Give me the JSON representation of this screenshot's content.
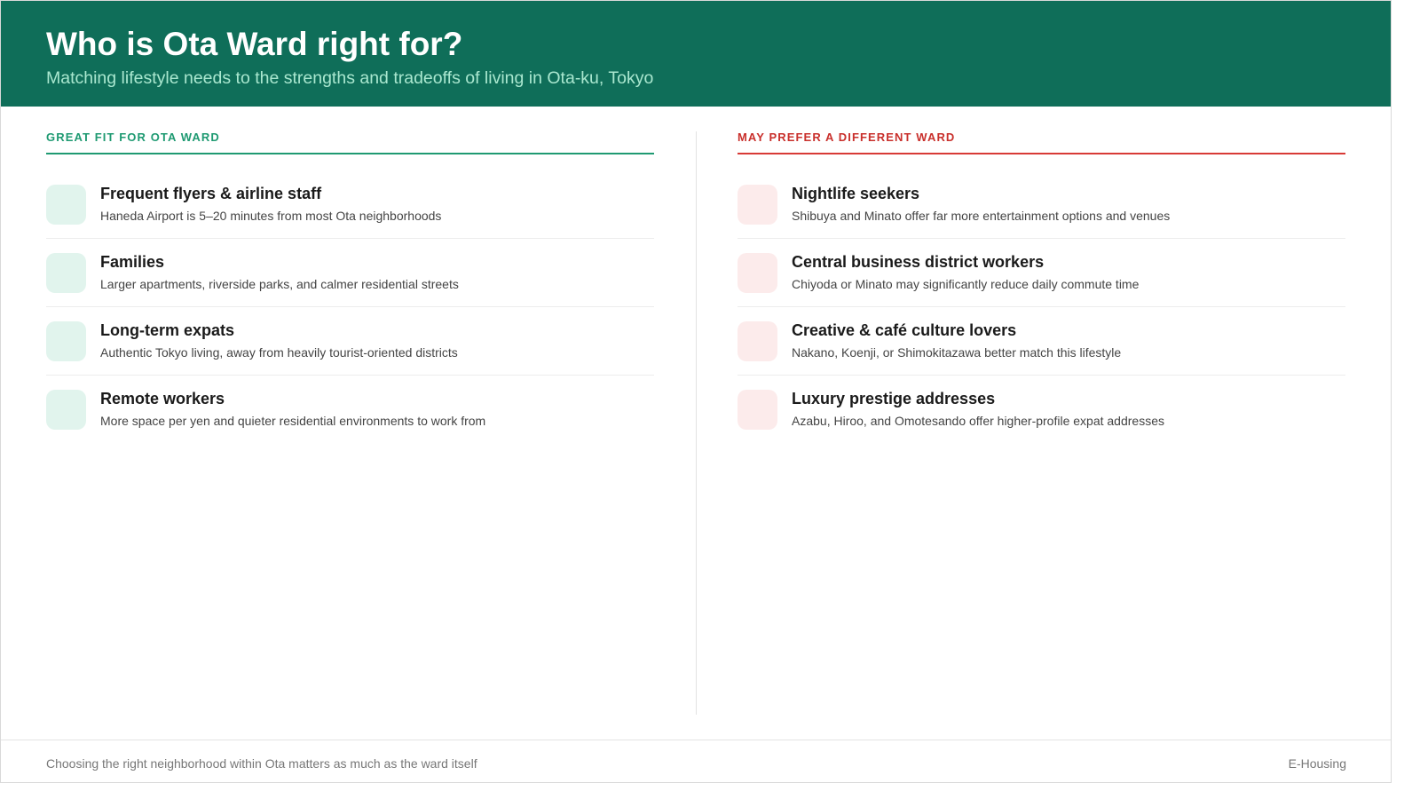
{
  "header": {
    "title": "Who is Ota Ward right for?",
    "subtitle": "Matching lifestyle needs to the strengths and tradeoffs of living in Ota-ku, Tokyo"
  },
  "colors": {
    "header_bg": "#0f6e59",
    "good_accent": "#1f9a72",
    "bad_accent": "#c9302c"
  },
  "good_fit": {
    "heading": "GREAT FIT FOR OTA WARD",
    "items": [
      {
        "title": "Frequent flyers & airline staff",
        "desc": "Haneda Airport is 5–20 minutes from most Ota neighborhoods"
      },
      {
        "title": "Families",
        "desc": "Larger apartments, riverside parks, and calmer residential streets"
      },
      {
        "title": "Long-term expats",
        "desc": "Authentic Tokyo living, away from heavily tourist-oriented districts"
      },
      {
        "title": "Remote workers",
        "desc": "More space per yen and quieter residential environments to work from"
      }
    ]
  },
  "other_ward": {
    "heading": "MAY PREFER A DIFFERENT WARD",
    "items": [
      {
        "title": "Nightlife seekers",
        "desc": "Shibuya and Minato offer far more entertainment options and venues"
      },
      {
        "title": "Central business district workers",
        "desc": "Chiyoda or Minato may significantly reduce daily commute time"
      },
      {
        "title": "Creative & café culture lovers",
        "desc": "Nakano, Koenji, or Shimokitazawa better match this lifestyle"
      },
      {
        "title": "Luxury prestige addresses",
        "desc": "Azabu, Hiroo, and Omotesando offer higher-profile expat addresses"
      }
    ]
  },
  "footer": {
    "note": "Choosing the right neighborhood within Ota matters as much as the ward itself",
    "brand": "E-Housing"
  }
}
